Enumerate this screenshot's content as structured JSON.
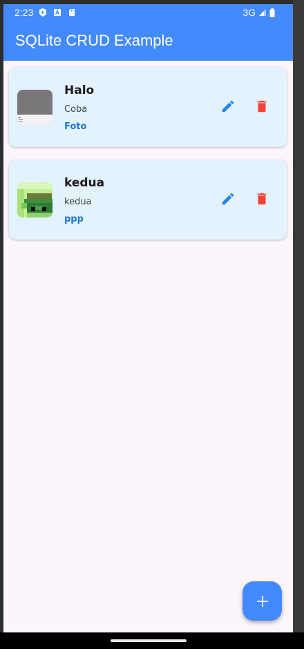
{
  "status_bar": {
    "time": "2:23",
    "network": "3G",
    "icons_left": [
      "play-protect-icon",
      "font-a-icon",
      "sd-card-icon"
    ],
    "icons_right": [
      "signal-icon",
      "battery-icon"
    ]
  },
  "app_bar": {
    "title": "SQLite CRUD Example"
  },
  "items": [
    {
      "title": "Halo",
      "subtitle": "Coba",
      "extra": "Foto",
      "thumbnail": "gray-photo-thumbnail"
    },
    {
      "title": "kedua",
      "subtitle": "kedua",
      "extra": "ppp",
      "thumbnail": "pixel-art-thumbnail"
    }
  ],
  "colors": {
    "primary": "#448aff",
    "card_background": "#e3f2fd",
    "page_background": "#fdf5fc",
    "edit_icon": "#1e88e5",
    "delete_icon": "#f44336",
    "extra_text": "#1976d2"
  },
  "fab": {
    "icon": "add-icon"
  }
}
